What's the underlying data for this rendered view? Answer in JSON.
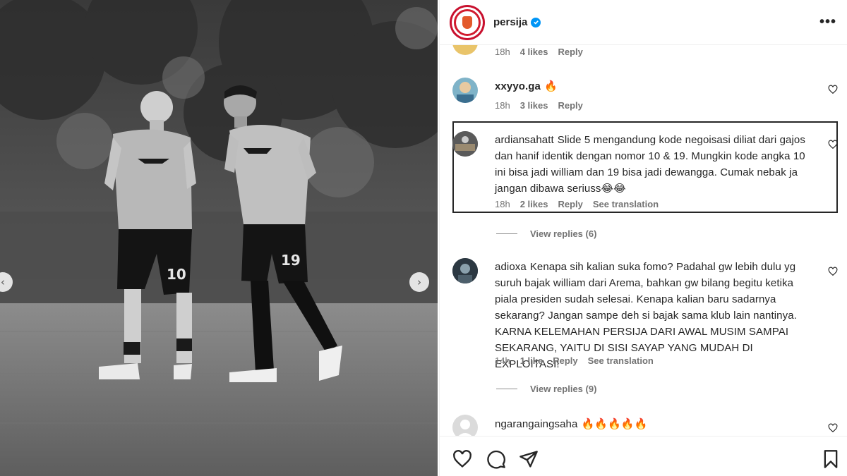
{
  "post": {
    "account": "persija",
    "verified": true,
    "brand_color": "#c8102e"
  },
  "photo": {
    "jersey_numbers": [
      "10",
      "19"
    ],
    "prev_icon": "chevron-left-icon",
    "next_icon": "chevron-right-icon",
    "prev_glyph": "‹",
    "next_glyph": "›"
  },
  "comments": [
    {
      "username": "",
      "text": "",
      "time": "18h",
      "likes": "4 likes",
      "reply": "Reply",
      "see_translation": ""
    },
    {
      "username": "xxyyo.ga",
      "text": "🔥",
      "time": "18h",
      "likes": "3 likes",
      "reply": "Reply"
    },
    {
      "username": "ardiansahatt",
      "text": "Slide 5 mengandung kode negoisasi diliat dari gajos dan hanif identik dengan nomor 10 & 19. Mungkin kode angka 10 ini bisa jadi william dan 19 bisa jadi dewangga. Cumak nebak ja jangan dibawa seriuss😂😂",
      "time": "18h",
      "likes": "2 likes",
      "reply": "Reply",
      "see_translation": "See translation",
      "view_replies": "View replies (6)"
    },
    {
      "username": "adioxa",
      "text": "Kenapa sih kalian suka fomo? Padahal gw lebih dulu yg suruh bajak william dari Arema, bahkan gw bilang begitu ketika piala presiden sudah selesai. Kenapa kalian baru sadarnya sekarang? Jangan sampe deh si bajak sama klub lain nantinya. KARNA KELEMAHAN PERSIJA DARI AWAL MUSIM SAMPAI SEKARANG, YAITU DI SISI SAYAP YANG MUDAH DI EXPLOITASI!",
      "time": "14h",
      "likes": "1 like",
      "reply": "Reply",
      "see_translation": "See translation",
      "view_replies": "View replies (9)"
    },
    {
      "username": "ngarangaingsaha",
      "text": "🔥🔥🔥🔥🔥"
    }
  ],
  "actions": [
    "heart-icon",
    "comment-icon",
    "share-icon",
    "bookmark-icon"
  ]
}
